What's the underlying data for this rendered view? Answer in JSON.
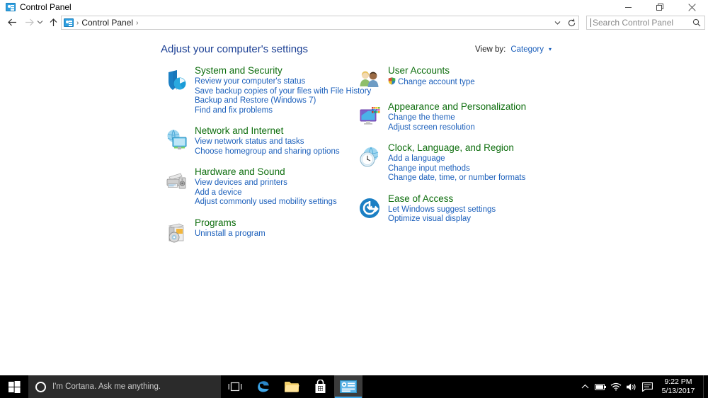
{
  "window": {
    "title": "Control Panel",
    "icon": "control-panel-icon",
    "controls": {
      "minimize": "minimize-button",
      "restore": "restore-button",
      "close": "close-button"
    }
  },
  "nav": {
    "back": "back-button",
    "forward": "forward-button",
    "recent": "recent-locations-button",
    "up": "up-button",
    "breadcrumb": {
      "icon": "control-panel-icon",
      "items": [
        "Control Panel"
      ],
      "separator": "›"
    },
    "address_chevron": "chevron-down-icon",
    "refresh": "refresh-icon"
  },
  "search": {
    "placeholder": "Search Control Panel",
    "value": "",
    "icon": "search-icon"
  },
  "main": {
    "heading": "Adjust your computer's settings",
    "view_by": {
      "label": "View by:",
      "value": "Category",
      "caret": "▾"
    },
    "left_column": [
      {
        "icon": "shield-clock-icon",
        "title": "System and Security",
        "links": [
          "Review your computer's status",
          "Save backup copies of your files with File History",
          "Backup and Restore (Windows 7)",
          "Find and fix problems"
        ]
      },
      {
        "icon": "network-globe-monitor-icon",
        "title": "Network and Internet",
        "links": [
          "View network status and tasks",
          "Choose homegroup and sharing options"
        ]
      },
      {
        "icon": "printer-speaker-icon",
        "title": "Hardware and Sound",
        "links": [
          "View devices and printers",
          "Add a device",
          "Adjust commonly used mobility settings"
        ]
      },
      {
        "icon": "programs-disc-icon",
        "title": "Programs",
        "links": [
          "Uninstall a program"
        ]
      }
    ],
    "right_column": [
      {
        "icon": "user-accounts-people-icon",
        "title": "User Accounts",
        "links": [
          "Change account type"
        ],
        "link_icons": [
          "uac-shield-icon"
        ]
      },
      {
        "icon": "appearance-monitor-palette-icon",
        "title": "Appearance and Personalization",
        "links": [
          "Change the theme",
          "Adjust screen resolution"
        ]
      },
      {
        "icon": "clock-globe-icon",
        "title": "Clock, Language, and Region",
        "links": [
          "Add a language",
          "Change input methods",
          "Change date, time, or number formats"
        ]
      },
      {
        "icon": "ease-of-access-icon",
        "title": "Ease of Access",
        "links": [
          "Let Windows suggest settings",
          "Optimize visual display"
        ]
      }
    ]
  },
  "taskbar": {
    "start": "windows-start-icon",
    "cortana": {
      "icon": "cortana-circle-icon",
      "text": "I'm Cortana. Ask me anything."
    },
    "task_view": "task-view-icon",
    "apps": [
      {
        "name": "edge-icon",
        "active": false
      },
      {
        "name": "file-explorer-icon",
        "active": false
      },
      {
        "name": "microsoft-store-icon",
        "active": false
      },
      {
        "name": "control-panel-taskbar-icon",
        "active": true
      }
    ],
    "tray": {
      "show_hidden": "chevron-up-icon",
      "battery": "battery-icon",
      "network": "wifi-icon",
      "volume": "speaker-icon",
      "action_center": "action-center-icon"
    },
    "clock": {
      "time": "9:22 PM",
      "date": "5/13/2017"
    }
  },
  "colors": {
    "heading_blue": "#1b3f94",
    "category_green": "#0e6e0e",
    "link_blue": "#1b5fbb",
    "taskbar_black": "#000000",
    "cortana_grey": "#2b2b2b",
    "accent_blue": "#3fa7e8"
  }
}
